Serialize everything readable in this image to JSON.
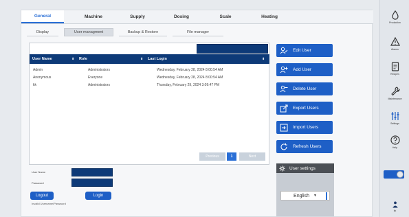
{
  "main_tabs": [
    {
      "label": "General",
      "active": true
    },
    {
      "label": "Machine"
    },
    {
      "label": "Supply"
    },
    {
      "label": "Dosing"
    },
    {
      "label": "Scale"
    },
    {
      "label": "Heating"
    }
  ],
  "sub_tabs": [
    {
      "label": "Display"
    },
    {
      "label": "User managment",
      "active": true
    },
    {
      "label": "Backup & Restore"
    },
    {
      "label": "File manager"
    }
  ],
  "table": {
    "headers": [
      "User Name",
      "Role",
      "Last Login"
    ],
    "rows": [
      {
        "user": "Admin",
        "role": "Administrators",
        "last_login": "Wednesday, February 28, 2024 8:00:54 AM"
      },
      {
        "user": "Anonymous",
        "role": "Everyone",
        "last_login": "Wednesday, February 28, 2024 8:00:54 AM"
      },
      {
        "user": "kk",
        "role": "Administrators",
        "last_login": "Thursday, February 29, 2024 3:09:47 PM"
      }
    ]
  },
  "pager": {
    "previous": "Previous",
    "page": "1",
    "next": "Next"
  },
  "actions": {
    "edit": "Edit User",
    "add": "Add User",
    "delete": "Delete User",
    "export": "Export Users",
    "import": "Import Users",
    "refresh": "Refresh Users"
  },
  "login": {
    "user_label": "User Name",
    "password_label": "Password",
    "logout": "Logout",
    "login": "Login",
    "error": "Invalid Username/Password"
  },
  "user_settings": {
    "title": "User settings",
    "language": "English"
  },
  "sidebar": {
    "production": "Production",
    "alarms": "Alarms",
    "recipes": "Recipes",
    "maintenance": "Maintenance",
    "settings": "Settings",
    "help": "Help",
    "user": "kk"
  },
  "colors": {
    "accent": "#1e5fc6",
    "header_dark": "#0d3a78",
    "active_tab": "#2a6fd6"
  }
}
